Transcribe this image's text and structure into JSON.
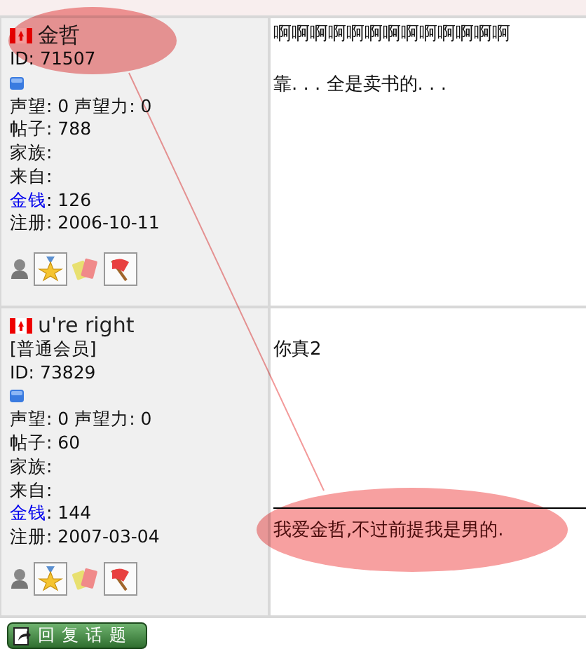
{
  "posts": [
    {
      "user": {
        "name": "金哲",
        "id": "ID: 71507",
        "stats": [
          {
            "kind": "plain",
            "text": "声望: 0 声望力: 0"
          },
          {
            "kind": "plain",
            "text": "帖子: 788"
          },
          {
            "kind": "plain",
            "text": "家族:"
          },
          {
            "kind": "plain",
            "text": "来自:"
          },
          {
            "kind": "link",
            "label": "金钱",
            "text": ": 126"
          },
          {
            "kind": "plain",
            "text": "注册: 2006-10-11"
          }
        ]
      },
      "body": [
        "啊啊啊啊啊啊啊啊啊啊啊啊啊",
        "靠. . . 全是卖书的. . ."
      ]
    },
    {
      "user": {
        "name": "u're right",
        "rank": "[普通会员]",
        "id": "ID: 73829",
        "stats": [
          {
            "kind": "plain",
            "text": "声望: 0 声望力: 0"
          },
          {
            "kind": "plain",
            "text": "帖子: 60"
          },
          {
            "kind": "plain",
            "text": "家族:"
          },
          {
            "kind": "plain",
            "text": "来自:"
          },
          {
            "kind": "link",
            "label": "金钱",
            "text": ": 144"
          },
          {
            "kind": "plain",
            "text": "注册: 2007-03-04"
          }
        ]
      },
      "body": [
        "你真2"
      ],
      "signature": "我爱金哲,不过前提我是男的."
    }
  ],
  "reply_button": "回复话题"
}
